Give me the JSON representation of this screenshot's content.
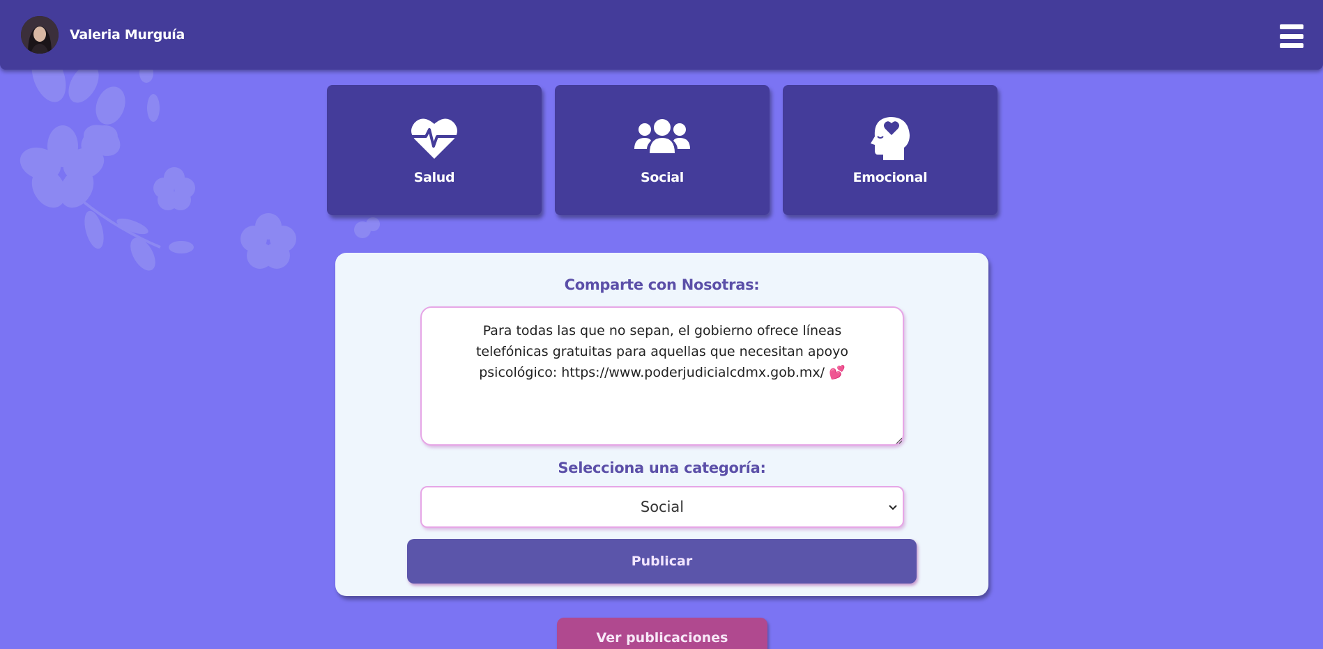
{
  "header": {
    "user_name": "Valeria Murguía",
    "avatar_icon": "user-avatar",
    "menu_icon": "hamburger-menu-icon"
  },
  "categories": [
    {
      "label": "Salud",
      "icon": "heart-pulse-icon"
    },
    {
      "label": "Social",
      "icon": "users-group-icon"
    },
    {
      "label": "Emocional",
      "icon": "head-heart-icon"
    }
  ],
  "form": {
    "title": "Comparte con Nosotras:",
    "post_text": "Para todas las que no sepan, el gobierno ofrece líneas telefónicas gratuitas para aquellas que necesitan apoyo psicológico: https://www.poderjudicialcdmx.gob.mx/ 💕",
    "category_label": "Selecciona una categoría:",
    "category_selected": "Social",
    "publish_label": "Publicar"
  },
  "view_posts_label": "Ver publicaciones",
  "colors": {
    "background": "#7b74f3",
    "header": "#443c9a",
    "panel": "#eff6fd",
    "accent_text": "#5b4fa8",
    "publish": "#5b55aa",
    "view_posts": "#b0498f",
    "field_border": "#e6a6e6"
  }
}
